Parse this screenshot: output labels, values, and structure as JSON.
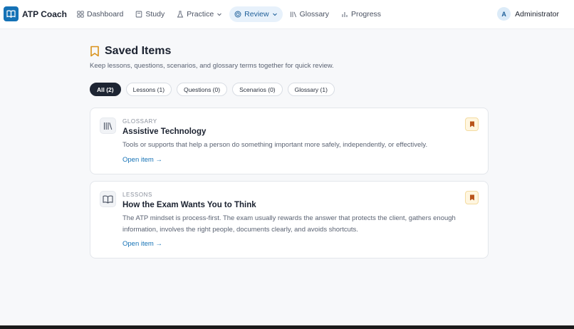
{
  "brand": {
    "name": "ATP Coach"
  },
  "nav": {
    "items": [
      {
        "label": "Dashboard",
        "icon": "dashboard-icon"
      },
      {
        "label": "Study",
        "icon": "book-icon"
      },
      {
        "label": "Practice",
        "icon": "flask-icon"
      },
      {
        "label": "Review",
        "icon": "target-icon"
      },
      {
        "label": "Glossary",
        "icon": "library-icon"
      },
      {
        "label": "Progress",
        "icon": "bar-chart-icon"
      }
    ],
    "active": "Review"
  },
  "user": {
    "initial": "A",
    "name": "Administrator"
  },
  "page": {
    "title": "Saved Items",
    "subtitle": "Keep lessons, questions, scenarios, and glossary terms together for quick review."
  },
  "filters": [
    {
      "label": "All (2)",
      "active": true
    },
    {
      "label": "Lessons (1)",
      "active": false
    },
    {
      "label": "Questions (0)",
      "active": false
    },
    {
      "label": "Scenarios (0)",
      "active": false
    },
    {
      "label": "Glossary (1)",
      "active": false
    }
  ],
  "items": [
    {
      "kind": "GLOSSARY",
      "title": "Assistive Technology",
      "description": "Tools or supports that help a person do something important more safely, independently, or effectively.",
      "link": "Open item →",
      "icon": "library-icon"
    },
    {
      "kind": "LESSONS",
      "title": "How the Exam Wants You to Think",
      "description": "The ATP mindset is process-first. The exam usually rewards the answer that protects the client, gathers enough information, involves the right people, documents clearly, and avoids shortcuts.",
      "link": "Open item →",
      "icon": "open-book-icon"
    }
  ],
  "colors": {
    "brand": "#1572b6",
    "bookmark": "#d9921a",
    "bookmark_saved": "#b8541c",
    "active_chip": "#1e2533"
  }
}
